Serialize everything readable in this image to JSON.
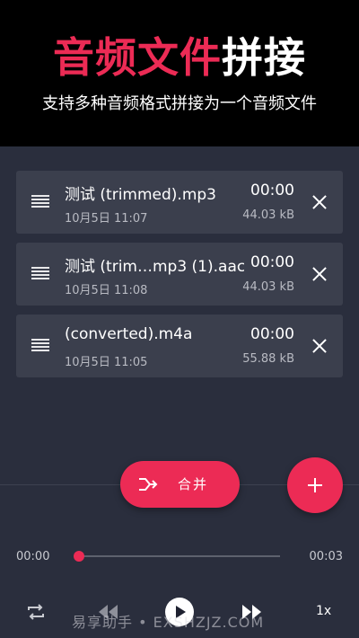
{
  "header": {
    "title_accent": "音频文件",
    "title_plain": "拼接",
    "subtitle": "支持多种音频格式拼接为一个音频文件"
  },
  "files": [
    {
      "name": "测试 (trimmed).mp3",
      "date": "10月5日 11:07",
      "duration": "00:00",
      "size": "44.03 kB"
    },
    {
      "name": "测试 (trim…mp3 (1).aac",
      "date": "10月5日 11:08",
      "duration": "00:00",
      "size": "44.03 kB"
    },
    {
      "name": "(converted).m4a",
      "date": "10月5日 11:05",
      "duration": "00:00",
      "size": "55.88 kB"
    }
  ],
  "icons": {
    "drag": "drag-handle-icon",
    "remove": "close-icon",
    "merge": "merge-arrows-icon",
    "add": "plus-icon",
    "repeat": "repeat-icon",
    "rewind": "rewind-icon",
    "play": "play-icon",
    "forward": "fast-forward-icon"
  },
  "actions": {
    "merge_label": "合并"
  },
  "player": {
    "current_time": "00:00",
    "total_time": "00:03",
    "progress": 0,
    "speed": "1x"
  },
  "watermark": "易享助手 • EXSHZJZ.COM",
  "colors": {
    "accent": "#ec2b55",
    "background": "#2a2e3d",
    "card": "#3b3f4d",
    "header_bg": "#000000"
  }
}
